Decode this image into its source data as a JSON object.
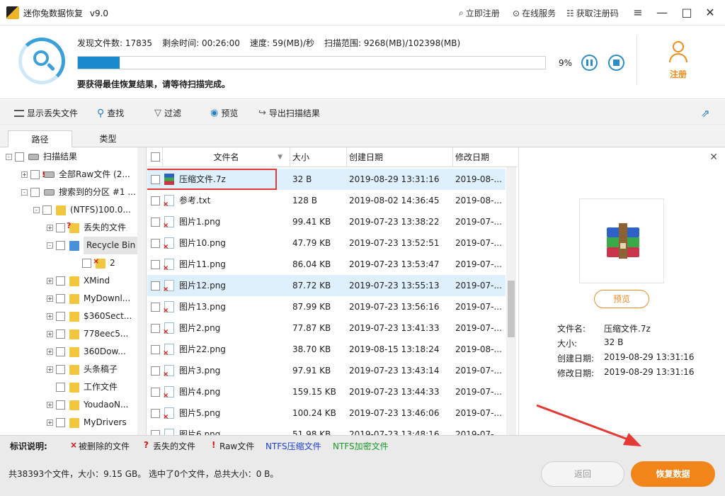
{
  "title": {
    "app_name": "迷你兔数据恢复",
    "version": "v9.0"
  },
  "title_links": {
    "register": "立即注册",
    "online_service": "在线服务",
    "get_code": "获取注册码"
  },
  "scan": {
    "files_label": "发现文件数:",
    "files_value": "17835",
    "time_label": "剩余时间:",
    "time_value": "00:26:00",
    "speed_label": "速度:",
    "speed_value": "59(MB)/秒",
    "range_label": "扫描范围:",
    "range_value": "9268(MB)/102398(MB)",
    "progress_fraction": 0.09,
    "percent_text": "9%",
    "hint": "要获得最佳恢复结果，请等待扫描完成。"
  },
  "register_button": {
    "label": "注册"
  },
  "toolbar": {
    "show_lost": "显示丢失文件",
    "find": "查找",
    "filter": "过滤",
    "preview": "预览",
    "export": "导出扫描结果"
  },
  "tabs": {
    "path": "路径",
    "type": "类型"
  },
  "tree": [
    {
      "label": "扫描结果",
      "level": 0,
      "expander": "-",
      "icon": "drive"
    },
    {
      "label": "全部Raw文件 (2...",
      "level": 1,
      "expander": "+",
      "icon": "drive-raw"
    },
    {
      "label": "搜索到的分区 #1 ...",
      "level": 1,
      "expander": "-",
      "icon": "drive"
    },
    {
      "label": "(NTFS)100.0...",
      "level": 2,
      "expander": "-",
      "icon": "folder"
    },
    {
      "label": "丢失的文件",
      "level": 3,
      "expander": "+",
      "icon": "folder-lost"
    },
    {
      "label": "Recycle Bin",
      "level": 3,
      "expander": "-",
      "icon": "recycle-bin",
      "selected": true
    },
    {
      "label": "2",
      "level": 4,
      "expander": "",
      "icon": "folder-deleted"
    },
    {
      "label": "XMind",
      "level": 3,
      "expander": "+",
      "icon": "folder"
    },
    {
      "label": "MyDownl...",
      "level": 3,
      "expander": "+",
      "icon": "folder"
    },
    {
      "label": "$360Sect...",
      "level": 3,
      "expander": "+",
      "icon": "folder"
    },
    {
      "label": "778eec5...",
      "level": 3,
      "expander": "+",
      "icon": "folder"
    },
    {
      "label": "360Dow...",
      "level": 3,
      "expander": "+",
      "icon": "folder"
    },
    {
      "label": "头条稿子",
      "level": 3,
      "expander": "+",
      "icon": "folder"
    },
    {
      "label": "工作文件",
      "level": 3,
      "expander": "",
      "icon": "folder"
    },
    {
      "label": "YoudaoN...",
      "level": 3,
      "expander": "+",
      "icon": "folder"
    },
    {
      "label": "MyDrivers",
      "level": 3,
      "expander": "+",
      "icon": "folder"
    }
  ],
  "table": {
    "headers": {
      "name": "文件名",
      "size": "大小",
      "created": "创建日期",
      "modified": "修改日期"
    },
    "rows": [
      {
        "name": "压缩文件.7z",
        "size": "32 B",
        "created": "2019-08-29 13:31:16",
        "modified": "2019-08-...",
        "highlight": true
      },
      {
        "name": "参考.txt",
        "size": "128 B",
        "created": "2019-08-02 14:36:45",
        "modified": "2019-08-..."
      },
      {
        "name": "图片1.png",
        "size": "99.41 KB",
        "created": "2019-07-23 13:38:22",
        "modified": "2019-07-..."
      },
      {
        "name": "图片10.png",
        "size": "47.79 KB",
        "created": "2019-07-23 13:52:51",
        "modified": "2019-07-..."
      },
      {
        "name": "图片11.png",
        "size": "86.04 KB",
        "created": "2019-07-23 13:53:47",
        "modified": "2019-07-..."
      },
      {
        "name": "图片12.png",
        "size": "87.72 KB",
        "created": "2019-07-23 13:55:13",
        "modified": "2019-07-...",
        "highlight": true
      },
      {
        "name": "图片13.png",
        "size": "87.99 KB",
        "created": "2019-07-23 13:56:16",
        "modified": "2019-07-..."
      },
      {
        "name": "图片2.png",
        "size": "77.87 KB",
        "created": "2019-07-23 13:41:33",
        "modified": "2019-07-..."
      },
      {
        "name": "图片22.png",
        "size": "38.70 KB",
        "created": "2019-08-15 13:18:24",
        "modified": "2019-08-..."
      },
      {
        "name": "图片3.png",
        "size": "97.91 KB",
        "created": "2019-07-23 13:43:14",
        "modified": "2019-07-..."
      },
      {
        "name": "图片4.png",
        "size": "159.15 KB",
        "created": "2019-07-23 13:44:33",
        "modified": "2019-07-..."
      },
      {
        "name": "图片5.png",
        "size": "100.24 KB",
        "created": "2019-07-23 13:46:06",
        "modified": "2019-07-..."
      },
      {
        "name": "图片6.png",
        "size": "51.98 KB",
        "created": "2019-07-23 13:48:16",
        "modified": "2019-07-..."
      }
    ]
  },
  "preview": {
    "button": "预览",
    "name_label": "文件名:",
    "name_value": "压缩文件.7z",
    "size_label": "大小:",
    "size_value": "32 B",
    "created_label": "创建日期:",
    "created_value": "2019-08-29 13:31:16",
    "modified_label": "修改日期:",
    "modified_value": "2019-08-29 13:31:16"
  },
  "legend": {
    "title": "标识说明:",
    "deleted_mark": "×",
    "deleted": "被删除的文件",
    "lost_mark": "?",
    "lost": "丢失的文件",
    "raw_mark": "!",
    "raw": "Raw文件",
    "ntfs_compressed": "NTFS压缩文件",
    "ntfs_encrypted": "NTFS加密文件"
  },
  "colors": {
    "accent": "#1a88cc",
    "orange": "#f28519",
    "highlight_row": "#def0fb",
    "selection_border": "#e53935",
    "ntfs_compressed": "#1f3fd6",
    "ntfs_encrypted": "#1a9a2a",
    "deleted_mark": "#d11111"
  },
  "status": {
    "summary": "共38393个文件，大小：9.15 GB。 选中了0个文件，总共大小：0 B。"
  },
  "footer_buttons": {
    "back": "返回",
    "recover": "恢复数据"
  }
}
